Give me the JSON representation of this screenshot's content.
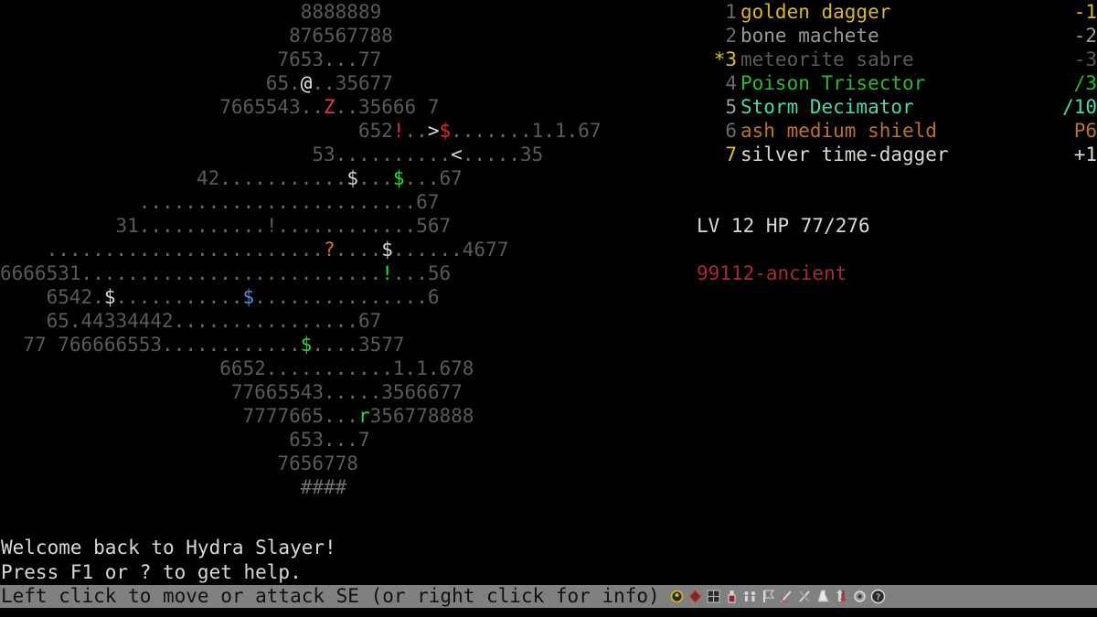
{
  "game": {
    "title": "Hydra Slayer"
  },
  "map": {
    "rows": [
      {
        "indent": 26,
        "cells": [
          {
            "t": "8888889",
            "c": "wall"
          }
        ]
      },
      {
        "indent": 25,
        "cells": [
          {
            "t": "876567788",
            "c": "wall"
          }
        ]
      },
      {
        "indent": 24,
        "cells": [
          {
            "t": "7653",
            "c": "wall"
          },
          {
            "t": "...",
            "c": "floor"
          },
          {
            "t": "77",
            "c": "wall"
          }
        ]
      },
      {
        "indent": 23,
        "cells": [
          {
            "t": "65",
            "c": "wall"
          },
          {
            "t": ".",
            "c": "floor"
          },
          {
            "t": "@",
            "c": "player"
          },
          {
            "t": "..",
            "c": "floor"
          },
          {
            "t": "35677",
            "c": "wall"
          }
        ]
      },
      {
        "indent": 19,
        "cells": [
          {
            "t": "7665543",
            "c": "wall"
          },
          {
            "t": "..",
            "c": "floor"
          },
          {
            "t": "Z",
            "c": "crimson"
          },
          {
            "t": "..",
            "c": "floor"
          },
          {
            "t": "35666",
            "c": "wall"
          },
          {
            "t": " ",
            "c": "floor"
          },
          {
            "t": "7",
            "c": "wall"
          }
        ]
      },
      {
        "indent": 31,
        "cells": [
          {
            "t": "652",
            "c": "wall"
          },
          {
            "t": "!",
            "c": "red"
          },
          {
            "t": "..",
            "c": "floor"
          },
          {
            "t": ">",
            "c": "white"
          },
          {
            "t": "$",
            "c": "red"
          },
          {
            "t": ".......",
            "c": "floor"
          },
          {
            "t": "1",
            "c": "wall"
          },
          {
            "t": ".",
            "c": "floor"
          },
          {
            "t": "1",
            "c": "wall"
          },
          {
            "t": ".",
            "c": "floor"
          },
          {
            "t": "67",
            "c": "wall"
          }
        ]
      },
      {
        "indent": 27,
        "cells": [
          {
            "t": "53",
            "c": "wall"
          },
          {
            "t": "..........",
            "c": "floor"
          },
          {
            "t": "<",
            "c": "white"
          },
          {
            "t": ".....",
            "c": "floor"
          },
          {
            "t": "35",
            "c": "wall"
          }
        ]
      },
      {
        "indent": 17,
        "cells": [
          {
            "t": "42",
            "c": "wall"
          },
          {
            "t": "...........",
            "c": "floor"
          },
          {
            "t": "$",
            "c": "white"
          },
          {
            "t": "...",
            "c": "floor"
          },
          {
            "t": "$",
            "c": "green"
          },
          {
            "t": "...",
            "c": "floor"
          },
          {
            "t": "67",
            "c": "wall"
          }
        ]
      },
      {
        "indent": 12,
        "cells": [
          {
            "t": "........................",
            "c": "floor"
          },
          {
            "t": "67",
            "c": "wall"
          }
        ]
      },
      {
        "indent": 10,
        "cells": [
          {
            "t": "31",
            "c": "wall"
          },
          {
            "t": "...........",
            "c": "floor"
          },
          {
            "t": "!",
            "c": "wall"
          },
          {
            "t": "............",
            "c": "floor"
          },
          {
            "t": "567",
            "c": "wall"
          }
        ]
      },
      {
        "indent": 4,
        "cells": [
          {
            "t": "........................",
            "c": "floor"
          },
          {
            "t": "?",
            "c": "orange"
          },
          {
            "t": "....",
            "c": "floor"
          },
          {
            "t": "$",
            "c": "white"
          },
          {
            "t": "......",
            "c": "floor"
          },
          {
            "t": "4677",
            "c": "wall"
          }
        ]
      },
      {
        "indent": 0,
        "cells": [
          {
            "t": "6666531",
            "c": "wall"
          },
          {
            "t": "..........................",
            "c": "floor"
          },
          {
            "t": "!",
            "c": "green"
          },
          {
            "t": "...",
            "c": "floor"
          },
          {
            "t": "56",
            "c": "wall"
          }
        ]
      },
      {
        "indent": 4,
        "cells": [
          {
            "t": "6542",
            "c": "wall"
          },
          {
            "t": ".",
            "c": "floor"
          },
          {
            "t": "$",
            "c": "white"
          },
          {
            "t": "...........",
            "c": "floor"
          },
          {
            "t": "$",
            "c": "blue"
          },
          {
            "t": "...............",
            "c": "floor"
          },
          {
            "t": "6",
            "c": "wall"
          }
        ]
      },
      {
        "indent": 4,
        "cells": [
          {
            "t": "65",
            "c": "wall"
          },
          {
            "t": ".",
            "c": "floor"
          },
          {
            "t": "44334442",
            "c": "wall"
          },
          {
            "t": "................",
            "c": "floor"
          },
          {
            "t": "67",
            "c": "wall"
          }
        ]
      },
      {
        "indent": 2,
        "cells": [
          {
            "t": "77",
            "c": "wall"
          },
          {
            "t": " ",
            "c": "floor"
          },
          {
            "t": "766666553",
            "c": "wall"
          },
          {
            "t": "............",
            "c": "floor"
          },
          {
            "t": "$",
            "c": "green"
          },
          {
            "t": "....",
            "c": "floor"
          },
          {
            "t": "3577",
            "c": "wall"
          }
        ]
      },
      {
        "indent": 19,
        "cells": [
          {
            "t": "6652",
            "c": "wall"
          },
          {
            "t": "...........",
            "c": "floor"
          },
          {
            "t": "1",
            "c": "wall"
          },
          {
            "t": ".",
            "c": "floor"
          },
          {
            "t": "1",
            "c": "wall"
          },
          {
            "t": ".",
            "c": "floor"
          },
          {
            "t": "678",
            "c": "wall"
          }
        ]
      },
      {
        "indent": 20,
        "cells": [
          {
            "t": "77665543",
            "c": "wall"
          },
          {
            "t": ".....",
            "c": "floor"
          },
          {
            "t": "3566677",
            "c": "wall"
          }
        ]
      },
      {
        "indent": 21,
        "cells": [
          {
            "t": "7777665",
            "c": "wall"
          },
          {
            "t": "...",
            "c": "floor"
          },
          {
            "t": "r",
            "c": "green"
          },
          {
            "t": "356778888",
            "c": "wall"
          }
        ]
      },
      {
        "indent": 25,
        "cells": [
          {
            "t": "653",
            "c": "wall"
          },
          {
            "t": "...",
            "c": "floor"
          },
          {
            "t": "7",
            "c": "wall"
          }
        ]
      },
      {
        "indent": 24,
        "cells": [
          {
            "t": "7656778",
            "c": "wall"
          }
        ]
      },
      {
        "indent": 26,
        "cells": [
          {
            "t": "####",
            "c": "hash"
          }
        ]
      }
    ]
  },
  "inventory": {
    "items": [
      {
        "index": "1",
        "name": "golden dagger",
        "value": "-1",
        "color": "#d6b82a",
        "index_color": "#6a6a6a"
      },
      {
        "index": "2",
        "name": "bone machete",
        "value": "-2",
        "color": "#9a9a9a",
        "index_color": "#6a6a6a"
      },
      {
        "index": "*3",
        "name": "meteorite sabre",
        "value": "-3",
        "color": "#5a5a5a",
        "index_color": "#d6c22a"
      },
      {
        "index": "4",
        "name": "Poison Trisector",
        "value": "/3",
        "color": "#2fb82f",
        "index_color": "#6a6a6a"
      },
      {
        "index": "5",
        "name": "Storm Decimator",
        "value": "/10",
        "color": "#4ed6b0",
        "index_color": "#9a9a9a"
      },
      {
        "index": "6",
        "name": "ash medium shield",
        "value": "P6",
        "color": "#b8732a",
        "index_color": "#6a6a6a"
      },
      {
        "index": "7",
        "name": "silver time-dagger",
        "value": "+1",
        "color": "#d8d8d8",
        "index_color": "#d6c22a"
      }
    ]
  },
  "stats": {
    "level_hp": "LV 12 HP 77/276",
    "seed": "99112-ancient",
    "seed_color": "#a82a3a"
  },
  "messages": {
    "lines": [
      "Welcome back to Hydra Slayer!",
      "Press F1 or ? to get help."
    ]
  },
  "status_bar": {
    "text": "Left click to move or attack SE (or right click for info)",
    "background": "#808080",
    "icons": [
      "bell-icon",
      "gem-icon",
      "grid-icon",
      "potion-icon",
      "footprints-icon",
      "flag-icon",
      "sword-swing-icon",
      "dual-sword-icon",
      "flask-icon",
      "arrows-icon",
      "gear-icon",
      "help-icon"
    ]
  }
}
